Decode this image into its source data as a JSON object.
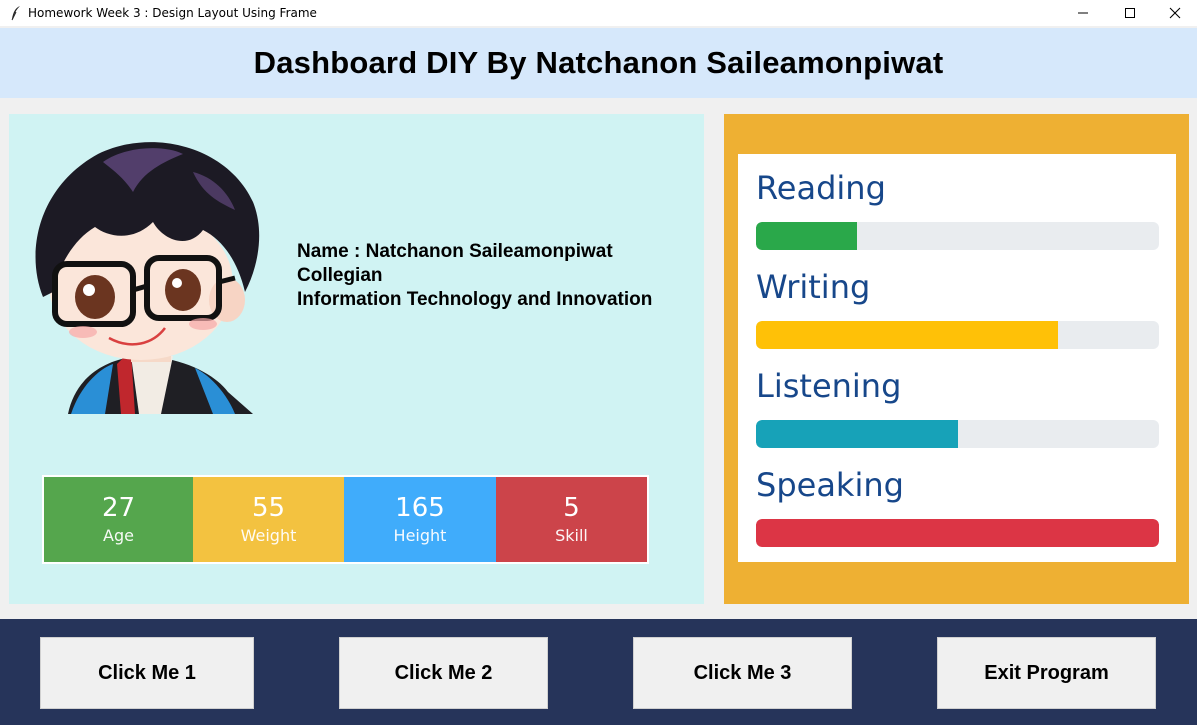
{
  "window": {
    "title": "Homework Week 3 : Design Layout Using Frame",
    "icon": "feather-icon",
    "controls": [
      "minimize-icon",
      "maximize-icon",
      "close-icon"
    ]
  },
  "header": {
    "title": "Dashboard DIY By Natchanon Saileamonpiwat"
  },
  "profile": {
    "avatar": "chibi-avatar-image",
    "name_line": "Name : Natchanon Saileamonpiwat",
    "role_line": "Collegian",
    "faculty_line": "Information Technology and Innovation",
    "stats": [
      {
        "value": "27",
        "label": "Age",
        "color": "#55a64d"
      },
      {
        "value": "55",
        "label": "Weight",
        "color": "#f3c240"
      },
      {
        "value": "165",
        "label": "Height",
        "color": "#40acfb"
      },
      {
        "value": "5",
        "label": "Skill",
        "color": "#cc444a"
      }
    ]
  },
  "skills": [
    {
      "name": "Reading",
      "progress": 0.25,
      "color": "#2aa84a"
    },
    {
      "name": "Writing",
      "progress": 0.75,
      "color": "#ffc107"
    },
    {
      "name": "Listening",
      "progress": 0.5,
      "color": "#17a2b8"
    },
    {
      "name": "Speaking",
      "progress": 1.0,
      "color": "#dc3545"
    }
  ],
  "buttons": {
    "btn1": "Click Me 1",
    "btn2": "Click Me 2",
    "btn3": "Click Me 3",
    "exit": "Exit Program"
  },
  "colors": {
    "header_bg": "#d6e8fb",
    "profile_bg": "#d0f3f3",
    "skills_frame": "#eeb033",
    "footer_bg": "#26345a",
    "skill_text": "#17478a"
  }
}
